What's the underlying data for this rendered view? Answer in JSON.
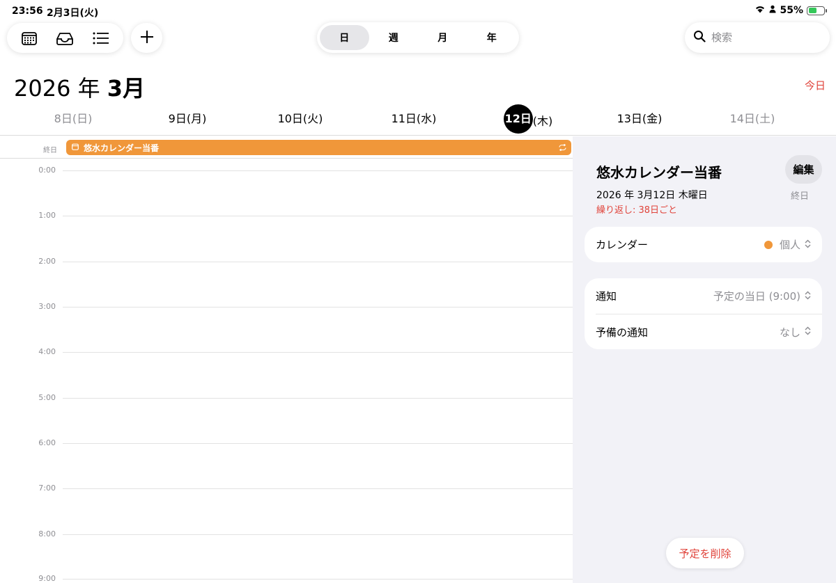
{
  "status": {
    "time": "23:56",
    "date": "2月3日(火)",
    "battery": "55%",
    "battery_level": 0.55
  },
  "toolbar": {
    "icons": [
      "calendar-icon",
      "inbox-icon",
      "list-icon"
    ],
    "add": "add-icon"
  },
  "view_switch": {
    "items": [
      "日",
      "週",
      "月",
      "年"
    ],
    "selected": "日"
  },
  "search": {
    "placeholder": "検索"
  },
  "header": {
    "year": "2026 年",
    "month": "3月",
    "today": "今日"
  },
  "days": [
    {
      "label": "8日(日)",
      "num": "8日",
      "dow": "(日)"
    },
    {
      "label": "9日(月)",
      "num": "9日",
      "dow": "(月)"
    },
    {
      "label": "10日(火)",
      "num": "10日",
      "dow": "(火)"
    },
    {
      "label": "11日(水)",
      "num": "11日",
      "dow": "(水)"
    },
    {
      "label": "12日(木)",
      "num": "12日",
      "dow": "(木)"
    },
    {
      "label": "13日(金)",
      "num": "13日",
      "dow": "(金)"
    },
    {
      "label": "14日(土)",
      "num": "14日",
      "dow": "(土)"
    }
  ],
  "allday": {
    "label": "終日",
    "event_title": "悠水カレンダー当番"
  },
  "hours": [
    "0:00",
    "1:00",
    "2:00",
    "3:00",
    "4:00",
    "5:00",
    "6:00",
    "7:00",
    "8:00",
    "9:00"
  ],
  "detail": {
    "title": "悠水カレンダー当番",
    "edit": "編集",
    "date": "2026 年 3月12日 木曜日",
    "allday": "終日",
    "repeat": "繰り返し: 38日ごと",
    "calendar": {
      "label": "カレンダー",
      "value": "個人",
      "color": "#f0973a"
    },
    "alert": {
      "label": "通知",
      "value": "予定の当日 (9:00)"
    },
    "second_alert": {
      "label": "予備の通知",
      "value": "なし"
    },
    "delete": "予定を削除"
  },
  "colors": {
    "accent": "#e0433a",
    "event": "#f0973a",
    "panel_bg": "#f2f2f7"
  }
}
